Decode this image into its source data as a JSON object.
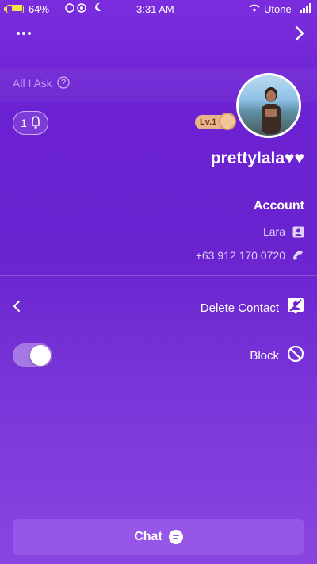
{
  "status_bar": {
    "battery": "64%",
    "time": "3:31 AM",
    "carrier": "Utone"
  },
  "header": {
    "more_icon": "ellipsis-icon",
    "back_icon": "chevron-right-icon"
  },
  "profile": {
    "ask_label": "All I Ask",
    "bell_count": "1",
    "level": "Lv.1",
    "username": "prettylala♥♥"
  },
  "account": {
    "title": "Account",
    "name": "Lara",
    "phone": "+63 912 170 0720"
  },
  "menu": {
    "delete_contact": "Delete Contact",
    "block": "Block",
    "block_enabled": true
  },
  "footer": {
    "chat_label": "Chat"
  },
  "colors": {
    "background": "#6c22d2",
    "chat_button": "#9657e8",
    "level_badge": "#e8b48a"
  }
}
